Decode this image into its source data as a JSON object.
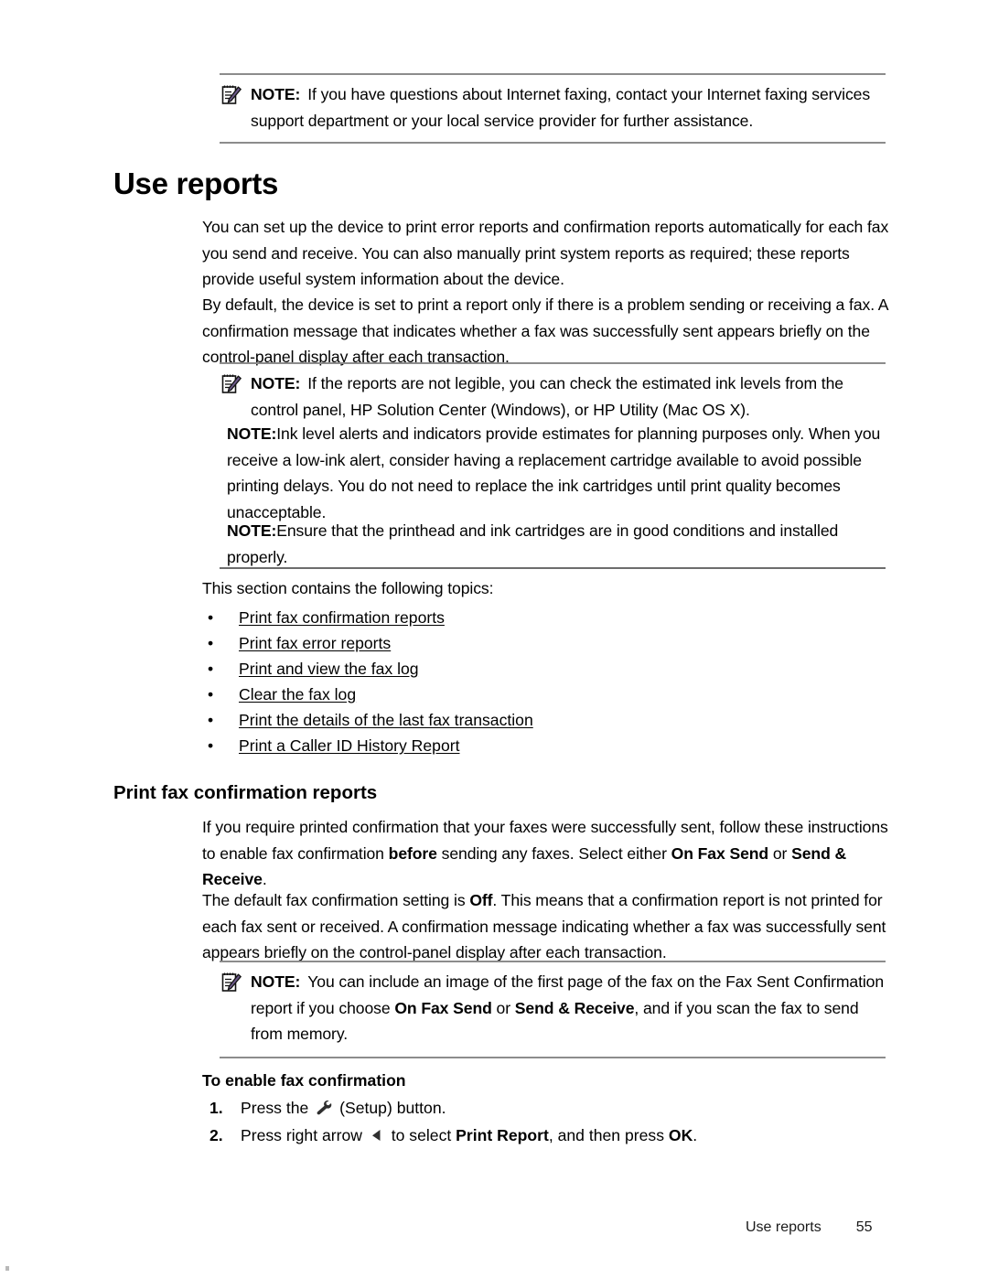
{
  "document": {
    "notes": {
      "label": "NOTE:",
      "internet_faxing": "If you have questions about Internet faxing, contact your Internet faxing services support department or your local service provider for further assistance.",
      "reports_legible": "If the reports are not legible, you can check the estimated ink levels from the control panel, HP Solution Center (Windows), or HP Utility (Mac OS X).",
      "ink_level_alerts": "Ink level alerts and indicators provide estimates for planning purposes only. When you receive a low-ink alert, consider having a replacement cartridge available to avoid possible printing delays. You do not need to replace the ink cartridges until print quality becomes unacceptable.",
      "printhead": "Ensure that the printhead and ink cartridges are in good conditions and installed properly.",
      "fax_sent_image_1": "You can include an image of the first page of the fax on the Fax Sent Confirmation report if you choose ",
      "fax_sent_image_bold_1": "On Fax Send",
      "fax_sent_image_2": " or ",
      "fax_sent_image_bold_2": "Send & Receive",
      "fax_sent_image_3": ", and if you scan the fax to send from memory."
    },
    "heading_use_reports": "Use reports",
    "para_1": "You can set up the device to print error reports and confirmation reports automatically for each fax you send and receive. You can also manually print system reports as required; these reports provide useful system information about the device.",
    "para_2": "By default, the device is set to print a report only if there is a problem sending or receiving a fax. A confirmation message that indicates whether a fax was successfully sent appears briefly on the control-panel display after each transaction.",
    "para_3": "This section contains the following topics:",
    "topics": [
      "Print fax confirmation reports",
      "Print fax error reports",
      "Print and view the fax log",
      "Clear the fax log",
      "Print the details of the last fax transaction",
      "Print a Caller ID History Report"
    ],
    "bullet_char": "•",
    "heading_print_fax_confirmation": "Print fax confirmation reports",
    "para_4": {
      "t1": "If you require printed confirmation that your faxes were successfully sent, follow these instructions to enable fax confirmation ",
      "b1": "before",
      "t2": " sending any faxes. Select either ",
      "b2": "On Fax Send",
      "t3": " or ",
      "b3": "Send & Receive",
      "t4": "."
    },
    "para_5": {
      "t1": "The default fax confirmation setting is ",
      "b1": "Off",
      "t2": ". This means that a confirmation report is not printed for each fax sent or received. A confirmation message indicating whether a fax was successfully sent appears briefly on the control-panel display after each transaction."
    },
    "heading_to_enable": "To enable fax confirmation",
    "steps": [
      {
        "number": "1.",
        "t1": "Press the ",
        "icon": "wrench-setup-icon",
        "t2": " (Setup) button."
      },
      {
        "number": "2.",
        "number_b": "2.",
        "t1": "Press right arrow ",
        "icon": "left-arrow-icon",
        "t2": " to select ",
        "b1": "Print Report",
        "t3": ", and then press ",
        "b2": "OK",
        "t4": "."
      }
    ],
    "footer": {
      "section": "Use reports",
      "page_number": "55"
    },
    "icons": {
      "note": "notepad-pencil-icon"
    },
    "colors": {
      "text": "#000000",
      "rule": "#8c8c8c",
      "background": "#ffffff"
    }
  }
}
